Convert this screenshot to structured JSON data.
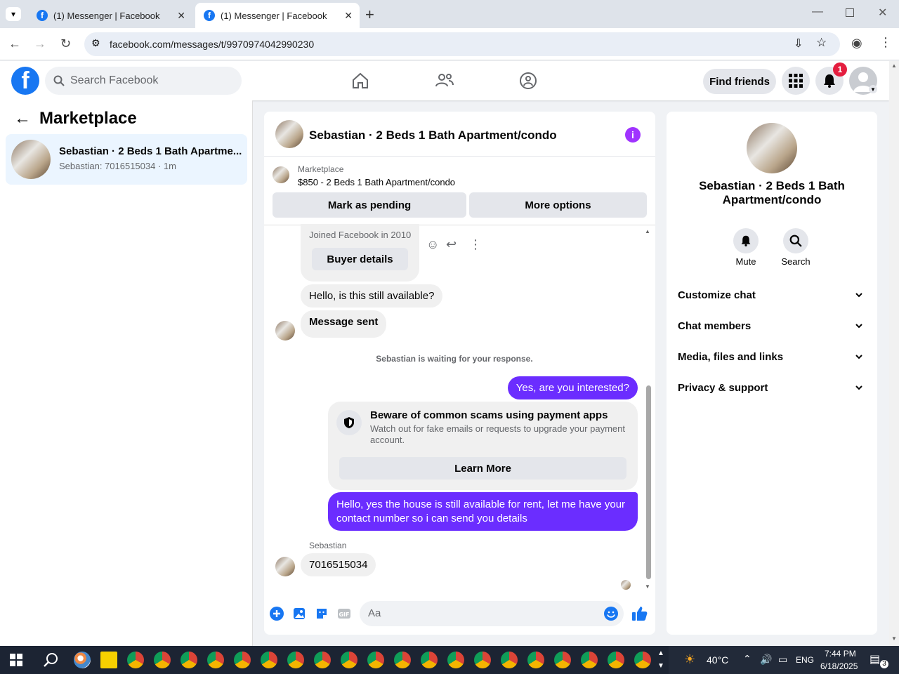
{
  "browser": {
    "tabs": [
      {
        "title": "(1) Messenger | Facebook",
        "active": false
      },
      {
        "title": "(1) Messenger | Facebook",
        "active": true
      }
    ],
    "url": "facebook.com/messages/t/9970974042990230"
  },
  "header": {
    "search_placeholder": "Search Facebook",
    "find_friends": "Find friends",
    "notif_count": "1"
  },
  "left": {
    "title": "Marketplace",
    "conversation": {
      "title": "Sebastian · 2 Beds 1 Bath Apartme...",
      "subtitle": "Sebastian: 7016515034 · 1m"
    }
  },
  "chat": {
    "title": "Sebastian · 2 Beds 1 Bath Apartment/condo",
    "marketplace_label": "Marketplace",
    "listing": "$850 - 2 Beds 1 Bath Apartment/condo",
    "mark_pending": "Mark as pending",
    "more_options": "More options",
    "joined": "Joined Facebook in 2010",
    "buyer_details": "Buyer details",
    "msg1": "Hello, is this still available?",
    "msg2": "Message sent",
    "waiting": "Sebastian is waiting for your response.",
    "out1": "Yes, are you interested?",
    "scam_title": "Beware of common scams using payment apps",
    "scam_body": "Watch out for fake emails or requests to upgrade your payment account.",
    "learn_more": "Learn More",
    "out2": "Hello, yes the house is still available for rent, let me have your contact number so i can send you details",
    "sender": "Sebastian",
    "msg3": "7016515034",
    "composer_placeholder": "Aa"
  },
  "right": {
    "name": "Sebastian · 2 Beds 1 Bath Apartment/condo",
    "mute": "Mute",
    "search": "Search",
    "rows": [
      "Customize chat",
      "Chat members",
      "Media, files and links",
      "Privacy & support"
    ]
  },
  "taskbar": {
    "temp": "40°C",
    "lang": "ENG",
    "time": "7:44 PM",
    "date": "6/18/2025",
    "notif": "3"
  },
  "colors": {
    "brand": "#1877f2",
    "outgoing": "#6b2dff",
    "info": "#a033ff"
  }
}
